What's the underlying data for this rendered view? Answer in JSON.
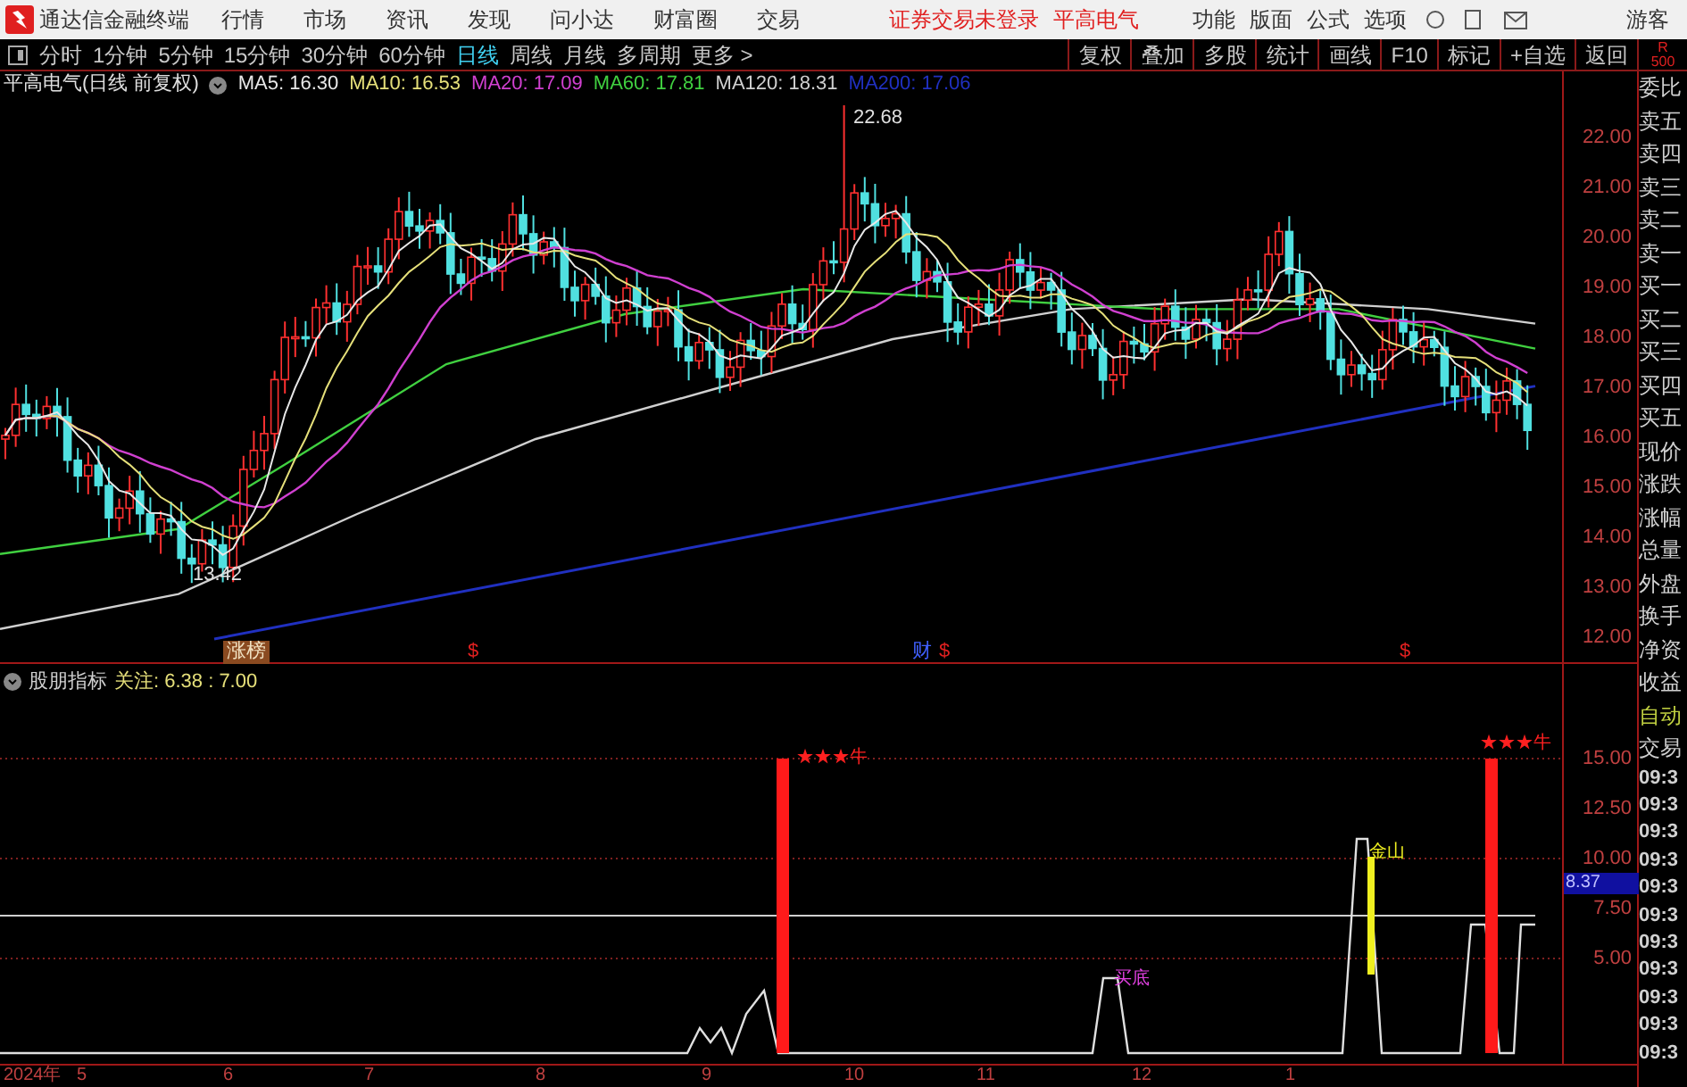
{
  "app_bar": {
    "title": "通达信金融终端",
    "menus": [
      "行情",
      "市场",
      "资讯",
      "发现",
      "问小达",
      "财富圈",
      "交易"
    ],
    "status": [
      "证券交易未登录",
      "平高电气"
    ],
    "tools": [
      "功能",
      "版面",
      "公式",
      "选项"
    ],
    "user": "游客"
  },
  "period_tabs": [
    {
      "label": "分时",
      "selected": false
    },
    {
      "label": "1分钟",
      "selected": false
    },
    {
      "label": "5分钟",
      "selected": false
    },
    {
      "label": "15分钟",
      "selected": false
    },
    {
      "label": "30分钟",
      "selected": false
    },
    {
      "label": "60分钟",
      "selected": false
    },
    {
      "label": "日线",
      "selected": true
    },
    {
      "label": "周线",
      "selected": false
    },
    {
      "label": "月线",
      "selected": false
    },
    {
      "label": "多周期",
      "selected": false
    },
    {
      "label": "更多 >",
      "selected": false
    }
  ],
  "chart_buttons": [
    "复权",
    "叠加",
    "多股",
    "统计",
    "画线",
    "F10",
    "标记",
    "+自选",
    "返回"
  ],
  "corner_badge": [
    "R",
    "500"
  ],
  "main_chart": {
    "title": "平高电气(日线 前复权)",
    "ma": [
      {
        "label": "MA5: 16.30",
        "color": "#e8e8e8"
      },
      {
        "label": "MA10: 16.53",
        "color": "#e6e07a"
      },
      {
        "label": "MA20: 17.09",
        "color": "#d040d0"
      },
      {
        "label": "MA60: 17.81",
        "color": "#40d040"
      },
      {
        "label": "MA120: 18.31",
        "color": "#d0d0d0"
      },
      {
        "label": "MA200: 17.06",
        "color": "#2030c0"
      }
    ],
    "price_axis": [
      "22.00",
      "21.00",
      "20.00",
      "19.00",
      "18.00",
      "17.00",
      "16.00",
      "15.00",
      "14.00",
      "13.00",
      "12.00"
    ],
    "high_label": "22.68",
    "low_label": "13.42",
    "markers": [
      {
        "text": "涨榜",
        "kind": "tag"
      },
      {
        "text": "$",
        "kind": "dollar"
      },
      {
        "text": "财",
        "kind": "finance"
      },
      {
        "text": "$",
        "kind": "dollar"
      },
      {
        "text": "$",
        "kind": "dollar"
      }
    ]
  },
  "indicator": {
    "title": "股朋指标",
    "reading": "关注: 6.38 : 7.00",
    "axis": [
      "15.00",
      "12.50",
      "10.00",
      "7.50",
      "5.00"
    ],
    "cursor_value": "8.37",
    "signals": [
      {
        "text": "★★★牛",
        "kind": "bull"
      },
      {
        "text": "买底",
        "kind": "bottom"
      },
      {
        "text": "金山",
        "kind": "gold"
      },
      {
        "text": "★★★牛",
        "kind": "bull"
      }
    ]
  },
  "time_axis": [
    "2024年",
    "5",
    "6",
    "7",
    "8",
    "9",
    "10",
    "11",
    "12",
    "1"
  ],
  "quote_panel": {
    "fields": [
      "委比",
      "卖五",
      "卖四",
      "卖三",
      "卖二",
      "卖一",
      "买一",
      "买二",
      "买三",
      "买四",
      "买五",
      "现价",
      "涨跌",
      "涨幅",
      "总量",
      "外盘",
      "换手",
      "净资",
      "收益"
    ],
    "mode": [
      "自动",
      "交易"
    ],
    "times": [
      "09:3",
      "09:3",
      "09:3",
      "09:3",
      "09:3",
      "09:3",
      "09:3",
      "09:3",
      "09:3",
      "09:3",
      "09:3"
    ]
  }
}
